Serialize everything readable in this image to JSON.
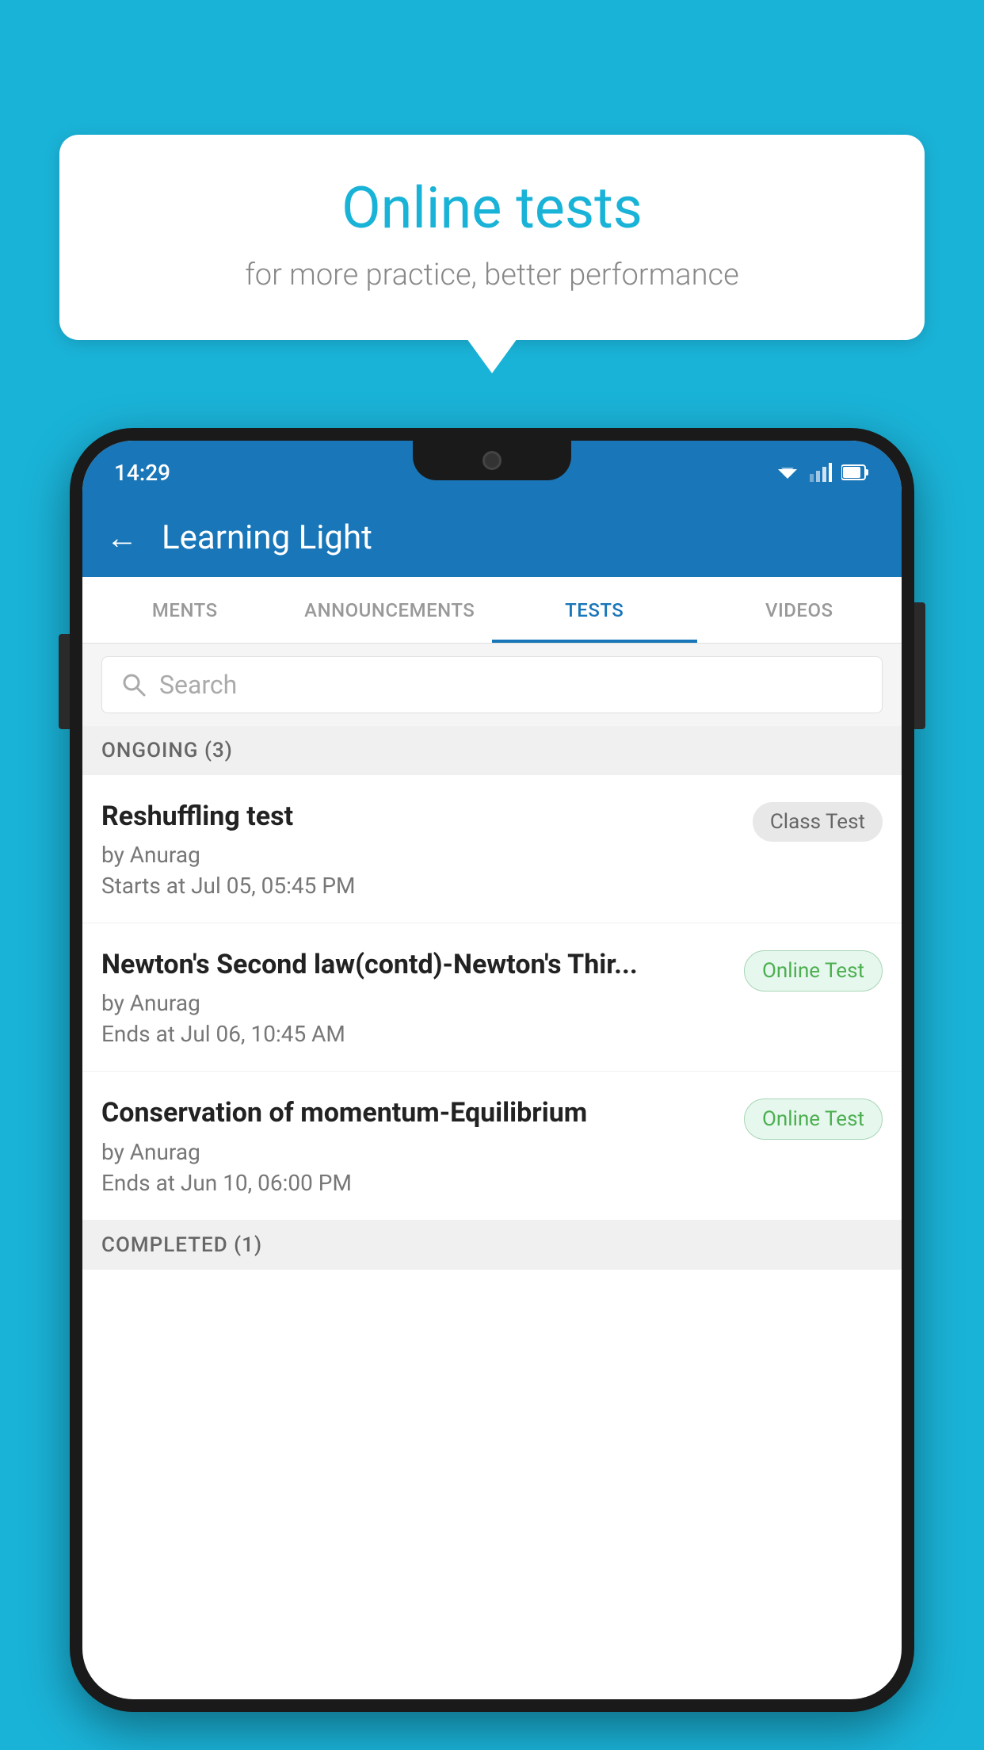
{
  "background_color": "#1ab3d8",
  "bubble": {
    "title": "Online tests",
    "subtitle": "for more practice, better performance"
  },
  "phone": {
    "status_bar": {
      "time": "14:29"
    },
    "app_bar": {
      "title": "Learning Light",
      "back_label": "←"
    },
    "tabs": [
      {
        "label": "MENTS",
        "active": false
      },
      {
        "label": "ANNOUNCEMENTS",
        "active": false
      },
      {
        "label": "TESTS",
        "active": true
      },
      {
        "label": "VIDEOS",
        "active": false
      }
    ],
    "search": {
      "placeholder": "Search"
    },
    "ongoing_section": {
      "label": "ONGOING (3)"
    },
    "test_items": [
      {
        "title": "Reshuffling test",
        "author": "by Anurag",
        "date": "Starts at  Jul 05, 05:45 PM",
        "badge": "Class Test",
        "badge_type": "class"
      },
      {
        "title": "Newton's Second law(contd)-Newton's Thir...",
        "author": "by Anurag",
        "date": "Ends at  Jul 06, 10:45 AM",
        "badge": "Online Test",
        "badge_type": "online"
      },
      {
        "title": "Conservation of momentum-Equilibrium",
        "author": "by Anurag",
        "date": "Ends at  Jun 10, 06:00 PM",
        "badge": "Online Test",
        "badge_type": "online"
      }
    ],
    "completed_section": {
      "label": "COMPLETED (1)"
    }
  }
}
